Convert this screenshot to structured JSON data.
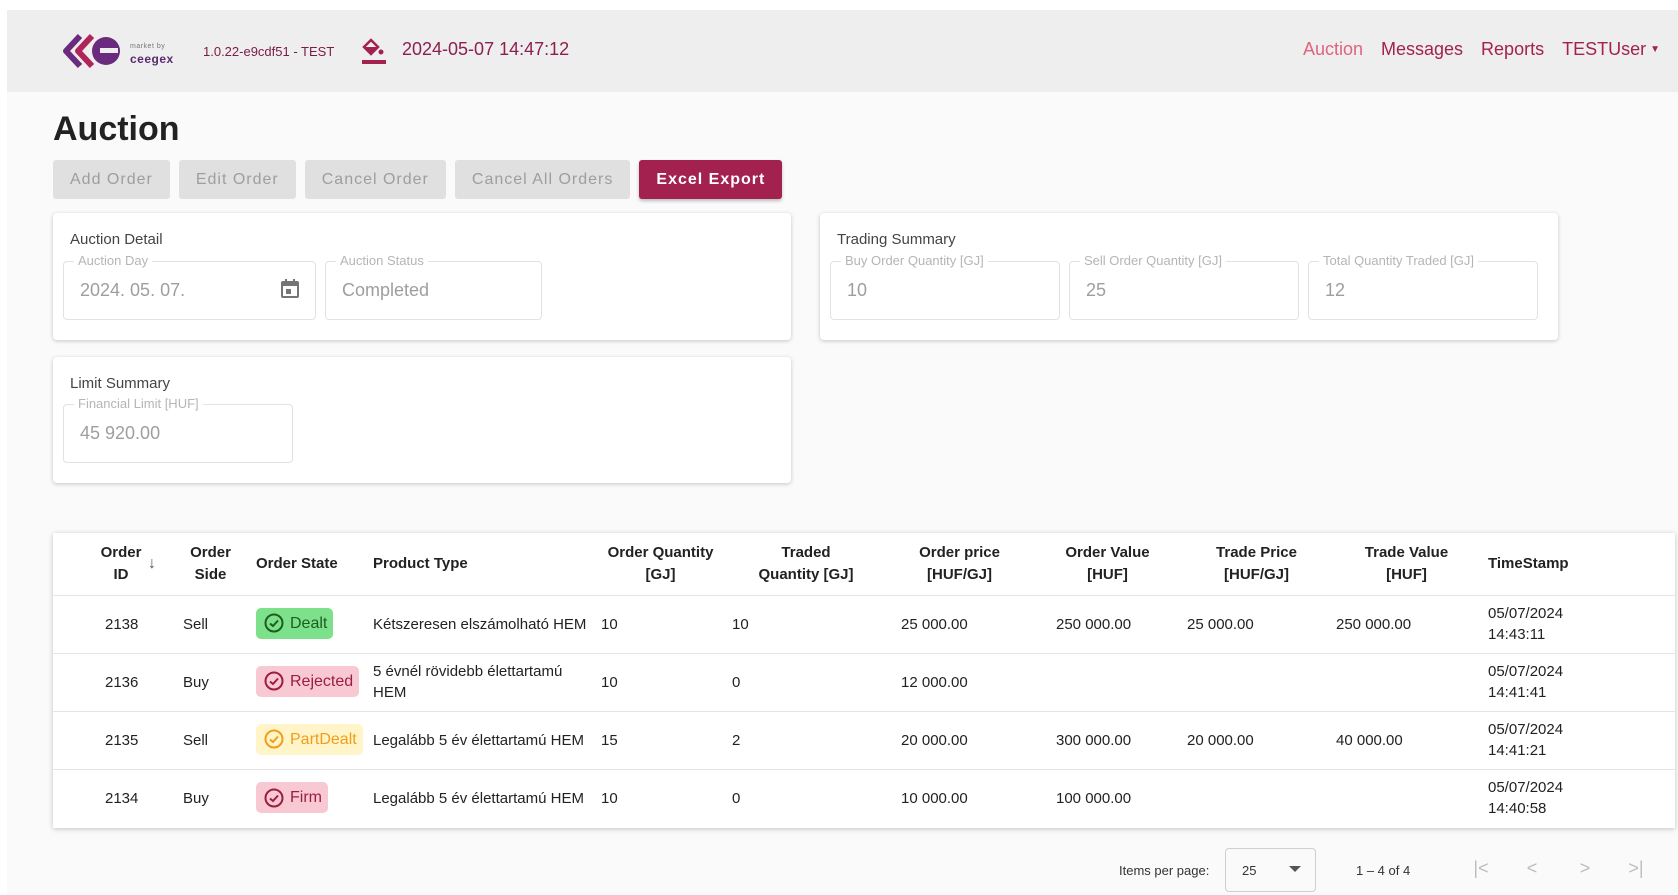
{
  "header": {
    "logo_small": "market by",
    "logo_brand": "ceegex",
    "version": "1.0.22-e9cdf51 - TEST",
    "datetime": "2024-05-07 14:47:12",
    "nav": [
      {
        "label": "Auction",
        "active": true
      },
      {
        "label": "Messages",
        "active": false
      },
      {
        "label": "Reports",
        "active": false
      }
    ],
    "user": "TESTUser"
  },
  "page": {
    "title": "Auction"
  },
  "toolbar": {
    "add_order": "Add Order",
    "edit_order": "Edit Order",
    "cancel_order": "Cancel Order",
    "cancel_all_orders": "Cancel All Orders",
    "excel_export": "Excel Export"
  },
  "auction_detail": {
    "title": "Auction Detail",
    "day_label": "Auction Day",
    "day_value": "2024. 05. 07.",
    "status_label": "Auction Status",
    "status_value": "Completed"
  },
  "trading_summary": {
    "title": "Trading Summary",
    "buy_label": "Buy Order Quantity [GJ]",
    "buy_value": "10",
    "sell_label": "Sell Order Quantity [GJ]",
    "sell_value": "25",
    "total_label": "Total Quantity Traded [GJ]",
    "total_value": "12"
  },
  "limit_summary": {
    "title": "Limit Summary",
    "financial_label": "Financial Limit [HUF]",
    "financial_value": "45 920.00"
  },
  "table": {
    "headers": {
      "order_id": "Order ID",
      "order_side": "Order Side",
      "order_state": "Order State",
      "product_type": "Product Type",
      "order_quantity": "Order Quantity [GJ]",
      "traded_quantity": "Traded Quantity [GJ]",
      "order_price": "Order price [HUF/GJ]",
      "order_value": "Order Value [HUF]",
      "trade_price": "Trade Price [HUF/GJ]",
      "trade_value": "Trade Value [HUF]",
      "timestamp": "TimeStamp"
    },
    "rows": [
      {
        "id": "2138",
        "side": "Sell",
        "state": "Dealt",
        "state_color": "#7de08a",
        "product": "Kétszeresen elszámolható HEM",
        "order_qty": "10",
        "traded_qty": "10",
        "order_price": "25 000.00",
        "order_value": "250 000.00",
        "trade_price": "25 000.00",
        "trade_value": "250 000.00",
        "ts_date": "05/07/2024",
        "ts_time": "14:43:11"
      },
      {
        "id": "2136",
        "side": "Buy",
        "state": "Rejected",
        "state_color": "#f9c9d3",
        "product": "5 évnél rövidebb élettartamú HEM",
        "order_qty": "10",
        "traded_qty": "0",
        "order_price": "12 000.00",
        "order_value": "",
        "trade_price": "",
        "trade_value": "",
        "ts_date": "05/07/2024",
        "ts_time": "14:41:41"
      },
      {
        "id": "2135",
        "side": "Sell",
        "state": "PartDealt",
        "state_color": "#fff5c9",
        "product": "Legalább 5 év élettartamú HEM",
        "order_qty": "15",
        "traded_qty": "2",
        "order_price": "20 000.00",
        "order_value": "300 000.00",
        "trade_price": "20 000.00",
        "trade_value": "40 000.00",
        "ts_date": "05/07/2024",
        "ts_time": "14:41:21"
      },
      {
        "id": "2134",
        "side": "Buy",
        "state": "Firm",
        "state_color": "#f9c9d3",
        "product": "Legalább 5 év élettartamú HEM",
        "order_qty": "10",
        "traded_qty": "0",
        "order_price": "10 000.00",
        "order_value": "100 000.00",
        "trade_price": "",
        "trade_value": "",
        "ts_date": "05/07/2024",
        "ts_time": "14:40:58"
      }
    ]
  },
  "paginator": {
    "items_per_page_label": "Items per page:",
    "items_per_page_value": "25",
    "range": "1 – 4 of 4"
  },
  "colors": {
    "brand": "#a3214f",
    "nav_active": "#e0637f"
  }
}
